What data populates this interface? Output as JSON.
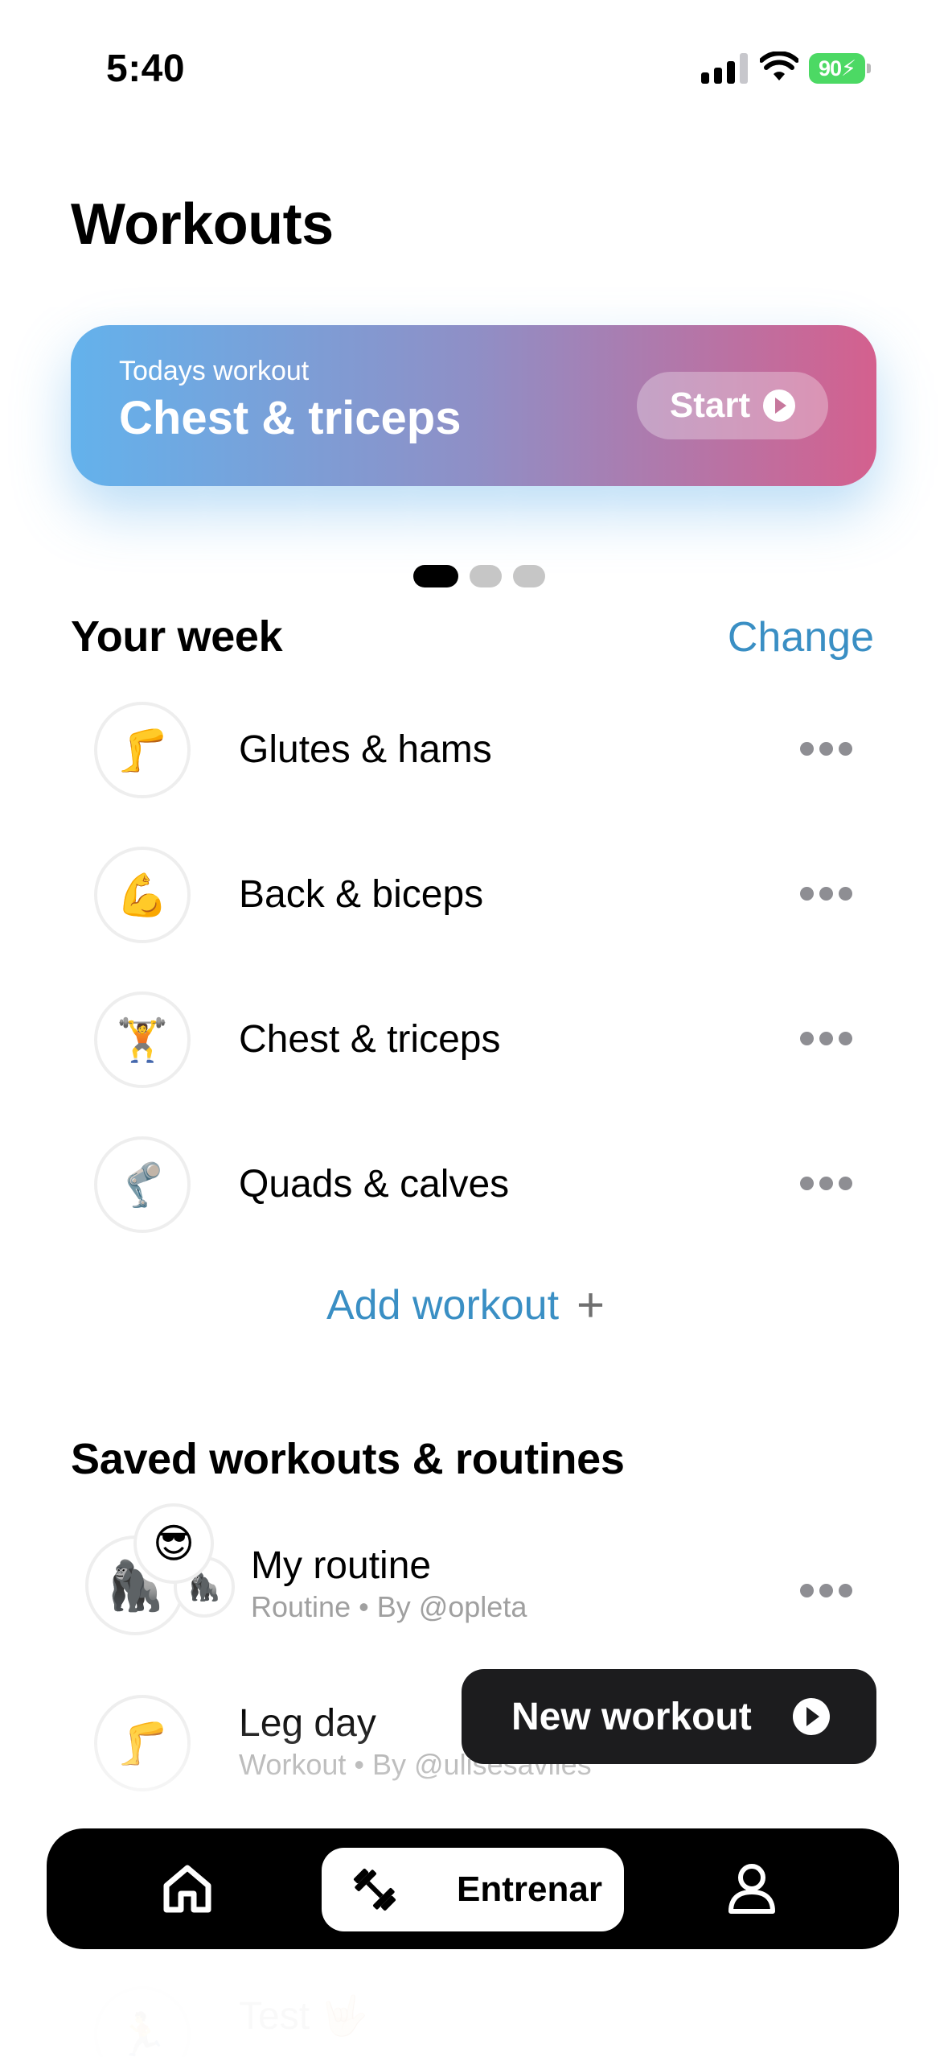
{
  "status_bar": {
    "time": "5:40",
    "battery": "90",
    "signal_icon": "cellular-signal-icon",
    "wifi_icon": "wifi-icon",
    "battery_icon": "battery-charging-icon"
  },
  "header": {
    "title": "Workouts"
  },
  "hero": {
    "subtitle": "Todays workout",
    "title": "Chest & triceps",
    "start_label": "Start",
    "page_count": 3,
    "active_page": 1
  },
  "week": {
    "title": "Your week",
    "change_label": "Change",
    "items": [
      {
        "emoji": "🦵",
        "label": "Glutes & hams"
      },
      {
        "emoji": "💪",
        "label": "Back & biceps"
      },
      {
        "emoji": "🏋️",
        "label": "Chest & triceps"
      },
      {
        "emoji": "🦿",
        "label": "Quads & calves"
      }
    ],
    "add_label": "Add workout"
  },
  "saved": {
    "title": "Saved workouts & routines",
    "items": [
      {
        "name": "My routine",
        "meta": "Routine • By @opleta",
        "emojis": [
          "🦍",
          "😎",
          "🦍"
        ]
      },
      {
        "name": "Leg day",
        "meta": "Workout • By @ulisesaviles",
        "emojis": [
          "🦵"
        ]
      }
    ],
    "ghost": {
      "name": "Test 🤟🏻",
      "emoji": "🏃"
    }
  },
  "fab": {
    "label": "New workout"
  },
  "tab_bar": {
    "home_icon": "home-icon",
    "train_icon": "dumbbell-icon",
    "train_label": "Entrenar",
    "profile_icon": "person-icon"
  },
  "colors": {
    "accent": "#3a8fc4",
    "hero_start": "#63b2ec",
    "hero_end": "#d4608e",
    "battery": "#4cd964"
  }
}
